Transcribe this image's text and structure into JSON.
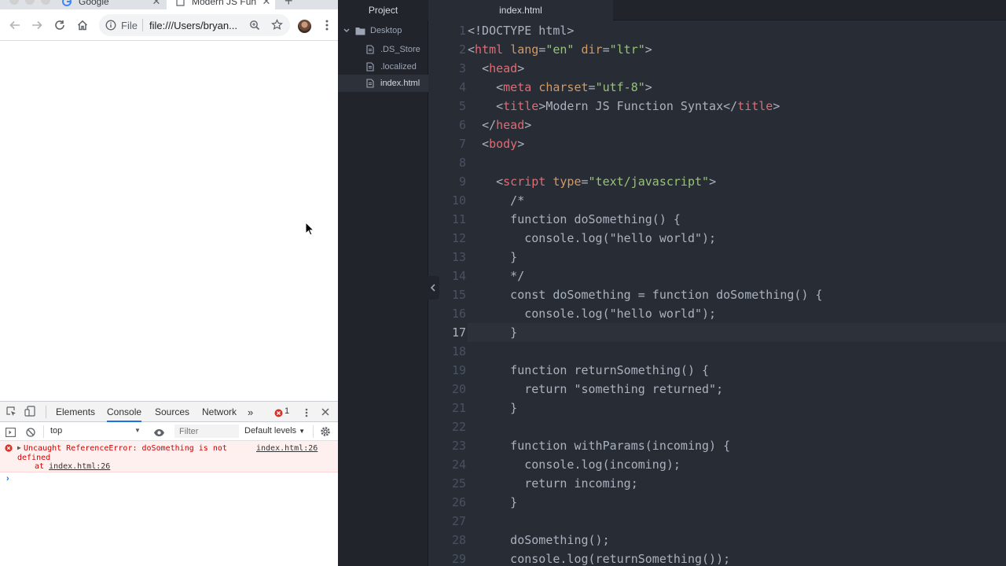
{
  "browser": {
    "tabs": [
      {
        "title": "Google",
        "favicon": "google-icon"
      },
      {
        "title": "Modern JS Func",
        "favicon": "page-icon"
      }
    ],
    "address": {
      "scheme_label": "File",
      "url": "file:///Users/bryan..."
    }
  },
  "devtools": {
    "tabs": [
      "Elements",
      "Console",
      "Sources",
      "Network"
    ],
    "error_count": "1",
    "context": "top",
    "filter_placeholder": "Filter",
    "levels": "Default levels",
    "error": {
      "message": "Uncaught ReferenceError: doSomething is not defined",
      "at_prefix": "at ",
      "at_link": "index.html:26",
      "source": "index.html:26"
    },
    "prompt": "›"
  },
  "editor": {
    "tree_tab": "Project",
    "tree": [
      {
        "label": "Desktop",
        "type": "folder"
      },
      {
        "label": ".DS_Store",
        "type": "file"
      },
      {
        "label": ".localized",
        "type": "file"
      },
      {
        "label": "index.html",
        "type": "file",
        "selected": true
      }
    ],
    "file_tab": "index.html",
    "current_line": 17,
    "lines": [
      [
        [
          "pun",
          "<!DOCTYPE html>"
        ]
      ],
      [
        [
          "pun",
          "<"
        ],
        [
          "tag",
          "html"
        ],
        [
          "txt",
          " "
        ],
        [
          "attr",
          "lang"
        ],
        [
          "pun",
          "="
        ],
        [
          "str",
          "\"en\""
        ],
        [
          "txt",
          " "
        ],
        [
          "attr",
          "dir"
        ],
        [
          "pun",
          "="
        ],
        [
          "str",
          "\"ltr\""
        ],
        [
          "pun",
          ">"
        ]
      ],
      [
        [
          "txt",
          "  "
        ],
        [
          "pun",
          "<"
        ],
        [
          "tag",
          "head"
        ],
        [
          "pun",
          ">"
        ]
      ],
      [
        [
          "txt",
          "    "
        ],
        [
          "pun",
          "<"
        ],
        [
          "tag",
          "meta"
        ],
        [
          "txt",
          " "
        ],
        [
          "attr",
          "charset"
        ],
        [
          "pun",
          "="
        ],
        [
          "str",
          "\"utf-8\""
        ],
        [
          "pun",
          ">"
        ]
      ],
      [
        [
          "txt",
          "    "
        ],
        [
          "pun",
          "<"
        ],
        [
          "tag",
          "title"
        ],
        [
          "pun",
          ">"
        ],
        [
          "txt",
          "Modern JS Function Syntax"
        ],
        [
          "pun",
          "</"
        ],
        [
          "tag",
          "title"
        ],
        [
          "pun",
          ">"
        ]
      ],
      [
        [
          "txt",
          "  "
        ],
        [
          "pun",
          "</"
        ],
        [
          "tag",
          "head"
        ],
        [
          "pun",
          ">"
        ]
      ],
      [
        [
          "txt",
          "  "
        ],
        [
          "pun",
          "<"
        ],
        [
          "tag",
          "body"
        ],
        [
          "pun",
          ">"
        ]
      ],
      [
        [
          "txt",
          ""
        ]
      ],
      [
        [
          "txt",
          "    "
        ],
        [
          "pun",
          "<"
        ],
        [
          "tag",
          "script"
        ],
        [
          "txt",
          " "
        ],
        [
          "attr",
          "type"
        ],
        [
          "pun",
          "="
        ],
        [
          "str",
          "\"text/javascript\""
        ],
        [
          "pun",
          ">"
        ]
      ],
      [
        [
          "txt",
          "      /*"
        ]
      ],
      [
        [
          "txt",
          "      function doSomething() {"
        ]
      ],
      [
        [
          "txt",
          "        console.log(\"hello world\");"
        ]
      ],
      [
        [
          "txt",
          "      }"
        ]
      ],
      [
        [
          "txt",
          "      */"
        ]
      ],
      [
        [
          "txt",
          "      const doSomething = function doSomething() {"
        ]
      ],
      [
        [
          "txt",
          "        console.log(\"hello world\");"
        ]
      ],
      [
        [
          "txt",
          "      }"
        ]
      ],
      [
        [
          "txt",
          ""
        ]
      ],
      [
        [
          "txt",
          "      function returnSomething() {"
        ]
      ],
      [
        [
          "txt",
          "        return \"something returned\";"
        ]
      ],
      [
        [
          "txt",
          "      }"
        ]
      ],
      [
        [
          "txt",
          ""
        ]
      ],
      [
        [
          "txt",
          "      function withParams(incoming) {"
        ]
      ],
      [
        [
          "txt",
          "        console.log(incoming);"
        ]
      ],
      [
        [
          "txt",
          "        return incoming;"
        ]
      ],
      [
        [
          "txt",
          "      }"
        ]
      ],
      [
        [
          "txt",
          ""
        ]
      ],
      [
        [
          "txt",
          "      doSomething();"
        ]
      ],
      [
        [
          "txt",
          "      console.log(returnSomething());"
        ]
      ]
    ]
  }
}
